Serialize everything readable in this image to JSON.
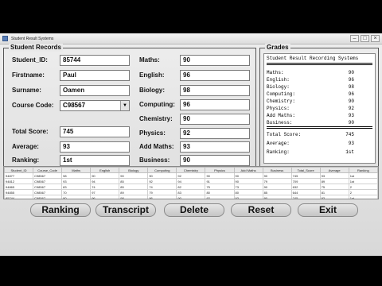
{
  "window": {
    "title": "Student Result Systems"
  },
  "records": {
    "panel_title": "Student Records",
    "student_id": {
      "label": "Student_ID:",
      "value": "85744"
    },
    "firstname": {
      "label": "Firstname:",
      "value": "Paul"
    },
    "surname": {
      "label": "Surname:",
      "value": "Oamen"
    },
    "course_code": {
      "label": "Course Code:",
      "value": "C98567"
    },
    "total_score": {
      "label": "Total Score:",
      "value": "745"
    },
    "average": {
      "label": "Average:",
      "value": "93"
    },
    "ranking": {
      "label": "Ranking:",
      "value": "1st"
    },
    "maths": {
      "label": "Maths:",
      "value": "90"
    },
    "english": {
      "label": "English:",
      "value": "96"
    },
    "biology": {
      "label": "Biology:",
      "value": "98"
    },
    "computing": {
      "label": "Computing:",
      "value": "96"
    },
    "chemistry": {
      "label": "Chemistry:",
      "value": "90"
    },
    "physics": {
      "label": "Physics:",
      "value": "92"
    },
    "add_maths": {
      "label": "Add Maths:",
      "value": "93"
    },
    "business": {
      "label": "Business:",
      "value": "90"
    }
  },
  "grades": {
    "panel_title": "Grades",
    "receipt_title": "Student Result Recording Systems",
    "rows": [
      {
        "k": "Maths:",
        "v": "90"
      },
      {
        "k": "English:",
        "v": "96"
      },
      {
        "k": "Biology:",
        "v": "98"
      },
      {
        "k": "Computing:",
        "v": "96"
      },
      {
        "k": "Chemistry:",
        "v": "90"
      },
      {
        "k": "Physics:",
        "v": "92"
      },
      {
        "k": "Add Maths:",
        "v": "93"
      },
      {
        "k": "Business:",
        "v": "90"
      }
    ],
    "summary": [
      {
        "k": "Total Score:",
        "v": "745"
      },
      {
        "k": "Average:",
        "v": "93"
      },
      {
        "k": "Ranking:",
        "v": "1st"
      }
    ]
  },
  "table": {
    "headers": [
      "Student_ID",
      "Course_Code",
      "Maths",
      "English",
      "Biology",
      "Computing",
      "Chemistry",
      "Physics",
      "Add Maths",
      "Business",
      "Total_Score",
      "Average",
      "Ranking"
    ],
    "rows": [
      [
        "94877",
        "C98567",
        "98",
        "90",
        "90",
        "90",
        "92",
        "90",
        "90",
        "90",
        "745",
        "93",
        "1st"
      ],
      [
        "94812",
        "C98567",
        "93",
        "94",
        "85",
        "92",
        "94",
        "91",
        "90",
        "79",
        "709",
        "89",
        "1st"
      ],
      [
        "94865",
        "C98567",
        "83",
        "74",
        "85",
        "74",
        "82",
        "75",
        "73",
        "90",
        "632",
        "75",
        "2"
      ],
      [
        "94855",
        "C98567",
        "70",
        "97",
        "89",
        "79",
        "83",
        "80",
        "80",
        "85",
        "644",
        "81",
        "2"
      ],
      [
        "85744",
        "C98567",
        "90",
        "96",
        "98",
        "96",
        "90",
        "92",
        "93",
        "90",
        "745",
        "93",
        "1st"
      ]
    ]
  },
  "buttons": {
    "ranking": "Ranking",
    "transcript": "Transcript",
    "delete": "Delete",
    "reset": "Reset",
    "exit": "Exit"
  }
}
